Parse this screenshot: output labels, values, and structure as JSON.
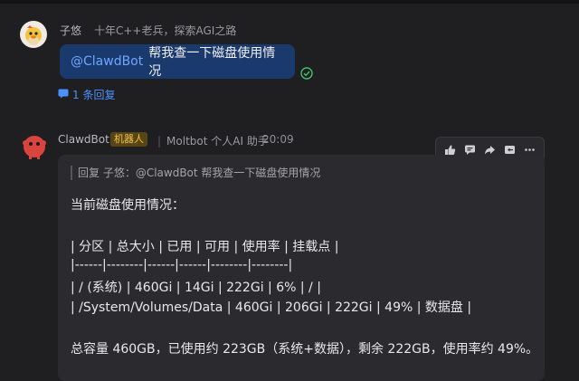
{
  "message1": {
    "author": "子悠",
    "signature": "十年C++老兵，探索AGI之路",
    "mention": "@ClawdBot",
    "text": "帮我查一下磁盘使用情况",
    "replies_label": "1 条回复"
  },
  "message2": {
    "author": "ClawdBot",
    "badge": "机器人",
    "signature": "Moltbot 个人AI 助手",
    "time": "20:09",
    "quote": "回复 子悠：@ClawdBot 帮我查一下磁盘使用情况",
    "lines": [
      "当前磁盘使用情况：",
      "| 分区 | 总大小 | 已用 | 可用 | 使用率 | 挂载点 |",
      "|------|--------|------|------|--------|--------|",
      "| / (系统) | 460Gi | 14Gi | 222Gi | 6% | / |",
      "| /System/Volumes/Data | 460Gi | 206Gi | 222Gi | 49% | 数据盘 |",
      "总容量 460GB，已使用约 223GB（系统+数据），剩余 222GB，使用率约 49%。"
    ]
  },
  "toolbar": {
    "icons": [
      "thumbs-up-icon",
      "comment-icon",
      "forward-icon",
      "reply-icon",
      "more-icon"
    ]
  },
  "colors": {
    "background": "#1f1f22",
    "bubble": "#1a3a6e",
    "link": "#4c92ff",
    "badge_bg": "#574516",
    "badge_text": "#f2c24d",
    "card": "#2b2b2f"
  }
}
